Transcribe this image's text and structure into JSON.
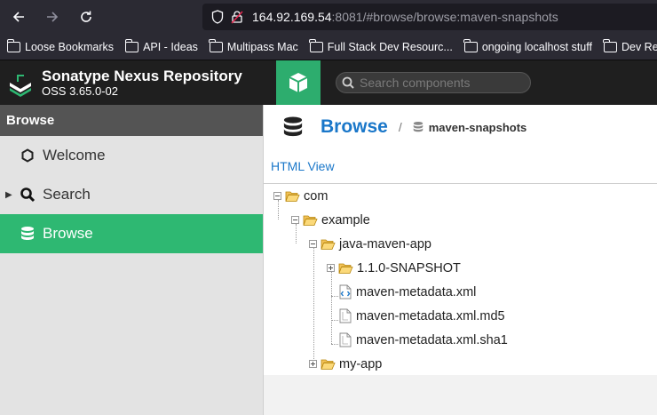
{
  "browser": {
    "url_host": "164.92.169.54",
    "url_rest": ":8081/#browse/browse:maven-snapshots",
    "bookmarks": [
      "Loose Bookmarks",
      "API - Ideas",
      "Multipass Mac",
      "Full Stack Dev Resourc...",
      "ongoing localhost stuff",
      "Dev Resources"
    ]
  },
  "header": {
    "title": "Sonatype Nexus Repository",
    "version": "OSS 3.65.0-02",
    "search_placeholder": "Search components"
  },
  "sidebar": {
    "section": "Browse",
    "items": [
      {
        "label": "Welcome",
        "icon": "hexagon-icon"
      },
      {
        "label": "Search",
        "icon": "search-icon"
      },
      {
        "label": "Browse",
        "icon": "database-icon"
      }
    ]
  },
  "main": {
    "breadcrumb_root": "Browse",
    "breadcrumb_sep": "/",
    "breadcrumb_leaf": "maven-snapshots",
    "html_view": "HTML View",
    "tree": [
      {
        "label": "com",
        "type": "folder",
        "toggle": "minus"
      },
      {
        "label": "example",
        "type": "folder",
        "toggle": "minus"
      },
      {
        "label": "java-maven-app",
        "type": "folder",
        "toggle": "minus"
      },
      {
        "label": "1.1.0-SNAPSHOT",
        "type": "folder",
        "toggle": "plus"
      },
      {
        "label": "maven-metadata.xml",
        "type": "xml-file"
      },
      {
        "label": "maven-metadata.xml.md5",
        "type": "file"
      },
      {
        "label": "maven-metadata.xml.sha1",
        "type": "file"
      },
      {
        "label": "my-app",
        "type": "folder",
        "toggle": "plus"
      }
    ]
  },
  "colors": {
    "accent_green": "#2eb872",
    "link_blue": "#1a77c9",
    "header_dark": "#1f1f1f"
  }
}
